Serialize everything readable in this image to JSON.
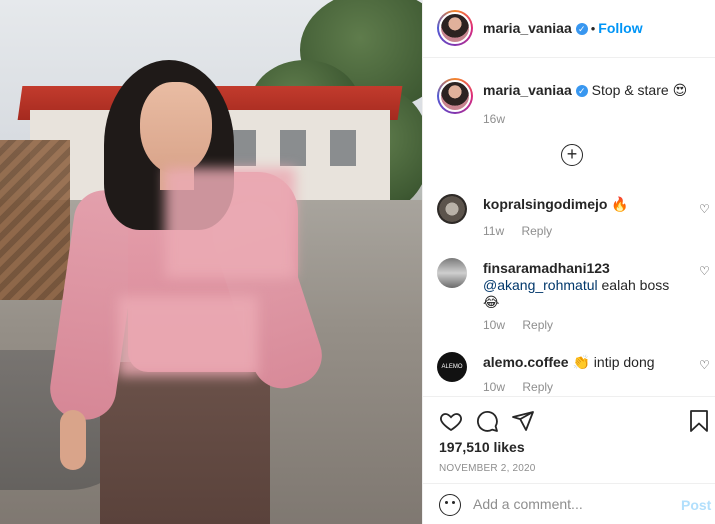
{
  "post": {
    "image_alt": "Photo of woman in pink top standing outdoors"
  },
  "header": {
    "username": "maria_vaniaa",
    "verified_mark": "✓",
    "separator": "•",
    "follow_label": "Follow"
  },
  "caption": {
    "username": "maria_vaniaa",
    "verified_mark": "✓",
    "text": "Stop & stare",
    "emoji": "😍",
    "time": "16w"
  },
  "load_more_icon": "plus-circle-icon",
  "comments": [
    {
      "username": "kopralsingodimejo",
      "text": "🔥",
      "time": "11w",
      "reply": "Reply"
    },
    {
      "username": "finsaramadhani123",
      "mention": "@akang_rohmatul",
      "text": "ealah boss",
      "emoji": "😂",
      "time": "10w",
      "reply": "Reply"
    },
    {
      "username": "alemo.coffee",
      "text": "👏 intip dong",
      "time": "10w",
      "reply": "Reply"
    }
  ],
  "actions": {
    "likes": "197,510 likes",
    "date": "NOVEMBER 2, 2020"
  },
  "add_comment": {
    "placeholder": "Add a comment...",
    "post_label": "Post"
  }
}
